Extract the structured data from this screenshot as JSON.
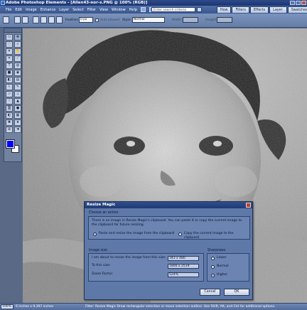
{
  "window": {
    "title": "Adobe Photoshop Elements - [Allen43-nor-s.PNG @ 100% (RGB)]"
  },
  "menubar": {
    "items": [
      "File",
      "Edit",
      "Image",
      "Enhance",
      "Layer",
      "Select",
      "Filter",
      "View",
      "Window",
      "Help"
    ],
    "search_placeholder": "Enter search criteria",
    "tabs": [
      "How To",
      "Filters",
      "Effects",
      "Layer Styles",
      "Swatches"
    ]
  },
  "options": {
    "feather_label": "Feather:",
    "feather_value": "0 px",
    "antialiased_label": "Anti-aliased",
    "style_label": "Style:",
    "style_value": "Normal",
    "width_label": "Width:",
    "height_label": "Height:"
  },
  "toolbox": {
    "icons": [
      "marquee-icon",
      "move-icon",
      "lasso-icon",
      "zoom-icon",
      "magic-wand-icon",
      "hand-icon",
      "crop-icon",
      "eyedropper-icon",
      "type-icon",
      "selection-brush-icon",
      "shape-icon",
      "red-eye-icon",
      "paint-bucket-icon",
      "gradient-icon",
      "brush-icon",
      "pencil-icon",
      "eraser-icon",
      "clone-stamp-icon",
      "smudge-icon",
      "blur-icon",
      "sponge-icon",
      "dodge-icon",
      "burn-icon",
      "pattern-stamp-icon",
      "impressionist-brush-icon",
      "custom-shape-icon",
      "zoom-tool-icon",
      "hand-tool-icon"
    ],
    "foreground_color": "#0000ff",
    "background_color": "#ffffff"
  },
  "dialog": {
    "title": "Resize Magic",
    "action_header": "Choose an action",
    "message": "There is an image in Resize Magic's clipboard. You can paste it or copy the current image to the clipboard for future resizing.",
    "option_paste": "Paste and resize the image from the clipboard",
    "option_copy": "Copy the current image to the clipboard",
    "size_header": "Image size",
    "about_label": "I am about to resize the image from this size:",
    "about_value": "343 x 480",
    "to_label": "To this size:",
    "to_value": "1800 x 2519",
    "zoom_label": "Zoom Factor:",
    "zoom_value": "524%",
    "sharpness_header": "Sharpness",
    "sharp_lower": "Lower",
    "sharp_normal": "Normal",
    "sharp_higher": "Higher",
    "selected_sharpness": "Higher",
    "cancel_label": "Cancel",
    "ok_label": "OK"
  },
  "status": {
    "zoom": "100%",
    "doc_size": "6 inches x 9.397 inches",
    "hint": "Filter: Resize Magic   Draw rectangular selection or move selection outline. Use Shift, Alt, and Ctrl for additional options."
  }
}
